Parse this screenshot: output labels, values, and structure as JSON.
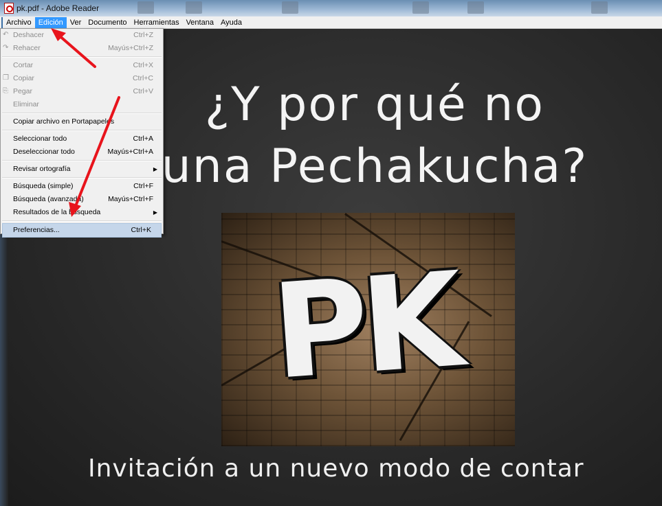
{
  "window": {
    "title": "pk.pdf - Adobe Reader"
  },
  "menubar": {
    "items": [
      "Archivo",
      "Edición",
      "Ver",
      "Documento",
      "Herramientas",
      "Ventana",
      "Ayuda"
    ],
    "active": "Edición"
  },
  "edit_menu": {
    "items": [
      {
        "label": "Deshacer",
        "shortcut": "Ctrl+Z"
      },
      {
        "label": "Rehacer",
        "shortcut": "Mayús+Ctrl+Z"
      },
      {
        "label": "Cortar",
        "shortcut": "Ctrl+X"
      },
      {
        "label": "Copiar",
        "shortcut": "Ctrl+C"
      },
      {
        "label": "Pegar",
        "shortcut": "Ctrl+V"
      },
      {
        "label": "Eliminar",
        "shortcut": ""
      },
      {
        "label": "Copiar archivo en Portapapeles",
        "shortcut": ""
      },
      {
        "label": "Seleccionar todo",
        "shortcut": "Ctrl+A"
      },
      {
        "label": "Deseleccionar todo",
        "shortcut": "Mayús+Ctrl+A"
      },
      {
        "label": "Revisar ortografía",
        "shortcut": ""
      },
      {
        "label": "Búsqueda (simple)",
        "shortcut": "Ctrl+F"
      },
      {
        "label": "Búsqueda (avanzada)",
        "shortcut": "Mayús+Ctrl+F"
      },
      {
        "label": "Resultados de la búsqueda",
        "shortcut": ""
      },
      {
        "label": "Preferencias...",
        "shortcut": "Ctrl+K"
      }
    ]
  },
  "slide": {
    "title_line1": "¿Y por qué no",
    "title_line2": "una Pechakucha?",
    "graffiti_text": "PK",
    "subtitle": "Invitación a un nuevo modo de contar"
  },
  "colors": {
    "menu_highlight": "#3399ff",
    "selected_item": "#c5d6ea",
    "annotation_arrow": "#e8141c",
    "slide_background": "#2b2b2b"
  }
}
